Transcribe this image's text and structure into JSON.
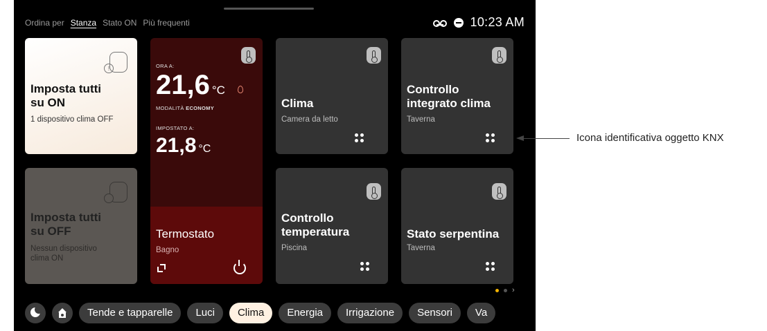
{
  "sort_bar": {
    "label": "Ordina per",
    "options": [
      "Stanza",
      "Stato ON",
      "Più frequenti"
    ],
    "selected": "Stanza"
  },
  "status_bar": {
    "icons": [
      "voicemail-icon",
      "do-not-disturb-icon"
    ],
    "time": "10:23 AM"
  },
  "tiles": {
    "all_on": {
      "title_line1": "Imposta tutti",
      "title_line2": "su ON",
      "subtitle": "1 dispositivo clima OFF",
      "icon": "thermometer-alert-icon"
    },
    "all_off": {
      "title_line1": "Imposta tutti",
      "title_line2": "su OFF",
      "subtitle_line1": "Nessun dispositivo",
      "subtitle_line2": "clima ON",
      "icon": "thermometer-off-icon"
    },
    "thermostat": {
      "now_label": "ORA A:",
      "now_value": "21,6",
      "unit": "°C",
      "mode_label": "MODALITÀ",
      "mode_value": "ECONOMY",
      "set_label": "IMPOSTATO A:",
      "set_value": "21,8",
      "title": "Termostato",
      "room": "Bagno",
      "heating_icon": "flame-icon",
      "colors": {
        "top": "#3a0a0a",
        "bottom": "#5d0a0a"
      }
    },
    "clima": {
      "title_line1": "Clima",
      "subtitle": "Camera da letto"
    },
    "controllo_integrato": {
      "title_line1": "Controllo",
      "title_line2": "integrato clima",
      "subtitle": "Taverna"
    },
    "controllo_temperatura": {
      "title_line1": "Controllo",
      "title_line2": "temperatura",
      "subtitle": "Piscina"
    },
    "stato_serpentina": {
      "title_line1": "Stato serpentina",
      "subtitle": "Taverna"
    }
  },
  "pager": {
    "pages": 2,
    "current": 1,
    "accent": "#f4b400"
  },
  "bottom_nav": {
    "icons": [
      "night-mode-icon",
      "home-icon"
    ],
    "categories": [
      "Tende e tapparelle",
      "Luci",
      "Clima",
      "Energia",
      "Irrigazione",
      "Sensori",
      "Va"
    ],
    "active": "Clima"
  },
  "annotation": {
    "text": "Icona identificativa oggetto KNX"
  }
}
